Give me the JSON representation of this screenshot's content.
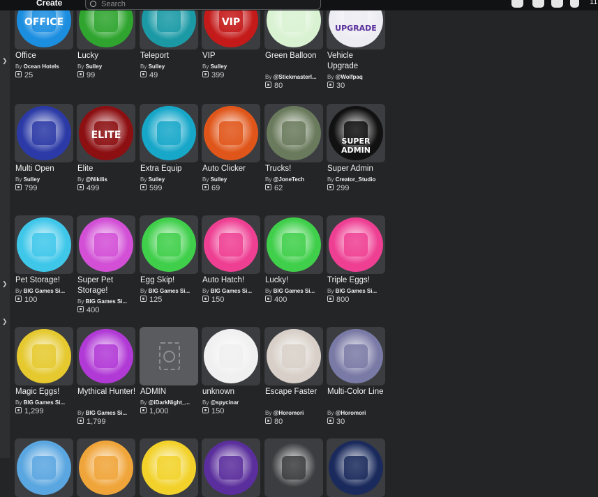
{
  "topbar": {
    "create_label": "Create",
    "search_placeholder": "Search",
    "right_icons": [
      "robux-icon",
      "chat-icon",
      "friends-icon",
      "shield-icon"
    ],
    "menu_tail": "11"
  },
  "rows": [
    [
      {
        "name": "Office",
        "creator": "Ocean Hotels",
        "price": "25",
        "icon": "office-icon",
        "bg": "#1c8ee0",
        "label": "OFFICE",
        "labelColor": "#ffffff"
      },
      {
        "name": "Lucky",
        "creator": "Sulley",
        "price": "99",
        "icon": "clover-icon",
        "bg": "#2fa52f",
        "label": "",
        "labelColor": ""
      },
      {
        "name": "Teleport",
        "creator": "Sulley",
        "price": "49",
        "icon": "teleport-icon",
        "bg": "#1b9aa6",
        "label": "",
        "labelColor": ""
      },
      {
        "name": "VIP",
        "creator": "Sulley",
        "price": "399",
        "icon": "vip-icon",
        "bg": "#c41a1a",
        "label": "VIP",
        "labelColor": "#ffffff"
      },
      {
        "name": "Green Balloon",
        "creator": "@StickmasterI...",
        "price": "80",
        "icon": "balloon-icon",
        "bg": "#d9f2d2",
        "label": "",
        "labelColor": ""
      },
      {
        "name": "Vehicle Upgrade",
        "creator": "@Wolfpaq",
        "price": "30",
        "icon": "car-upgrade-icon",
        "bg": "#ececf2",
        "label": "UPGRADE",
        "labelColor": "#5a2e9c"
      }
    ],
    [
      {
        "name": "Multi Open",
        "creator": "Sulley",
        "price": "799",
        "icon": "stars-icon",
        "bg": "#2b3aa6",
        "label": "",
        "labelColor": ""
      },
      {
        "name": "Elite",
        "creator": "@Nikilis",
        "price": "499",
        "icon": "skull-icon",
        "bg": "#8c0f12",
        "label": "ELITE",
        "labelColor": "#ffffff"
      },
      {
        "name": "Extra Equip",
        "creator": "Sulley",
        "price": "599",
        "icon": "plus-smile-icon",
        "bg": "#17a7c9",
        "label": "",
        "labelColor": ""
      },
      {
        "name": "Auto Clicker",
        "creator": "Sulley",
        "price": "69",
        "icon": "hand-click-icon",
        "bg": "#e0561a",
        "label": "",
        "labelColor": ""
      },
      {
        "name": "Trucks!",
        "creator": "@JoneTech",
        "price": "62",
        "icon": "truck-icon",
        "bg": "#6a7a5c",
        "label": "",
        "labelColor": ""
      },
      {
        "name": "Super Admin",
        "creator": "Creator_Studio",
        "price": "299",
        "icon": "super-admin-icon",
        "bg": "#111111",
        "label": "SUPER ADMIN",
        "labelColor": "#ffffff"
      }
    ],
    [
      {
        "name": "Pet Storage!",
        "creator": "BIG Games Si...",
        "price": "100",
        "icon": "backpack-icon",
        "bg": "#3fc7ea",
        "label": "",
        "labelColor": ""
      },
      {
        "name": "Super Pet Storage!",
        "creator": "BIG Games Si...",
        "price": "400",
        "icon": "super-backpack-icon",
        "bg": "#d24fd6",
        "label": "",
        "labelColor": ""
      },
      {
        "name": "Egg Skip!",
        "creator": "BIG Games Si...",
        "price": "125",
        "icon": "skip-icon",
        "bg": "#3fcf4a",
        "label": "",
        "labelColor": ""
      },
      {
        "name": "Auto Hatch!",
        "creator": "BIG Games Si...",
        "price": "150",
        "icon": "egg-hatch-icon",
        "bg": "#ee3f93",
        "label": "",
        "labelColor": ""
      },
      {
        "name": "Lucky!",
        "creator": "BIG Games Si...",
        "price": "400",
        "icon": "clover-icon",
        "bg": "#3fcf4a",
        "label": "",
        "labelColor": ""
      },
      {
        "name": "Triple Eggs!",
        "creator": "BIG Games Si...",
        "price": "800",
        "icon": "triple-eggs-icon",
        "bg": "#ee3f93",
        "label": "",
        "labelColor": ""
      }
    ],
    [
      {
        "name": "Magic Eggs!",
        "creator": "BIG Games Si...",
        "price": "1,299",
        "icon": "rainbow-egg-icon",
        "bg": "#e5c92f",
        "label": "",
        "labelColor": ""
      },
      {
        "name": "Mythical Hunter!",
        "creator": "BIG Games Si...",
        "price": "1,799",
        "icon": "mythical-clover-icon",
        "bg": "#b13ad6",
        "label": "",
        "labelColor": ""
      },
      {
        "name": "ADMIN",
        "creator": "@iDarkNight_...",
        "price": "1,000",
        "icon": "no-image-icon",
        "bg": "",
        "label": "",
        "labelColor": ""
      },
      {
        "name": "unknown",
        "creator": "@spycinar",
        "price": "150",
        "icon": "character-icon",
        "bg": "#f0f0f0",
        "label": "",
        "labelColor": ""
      },
      {
        "name": "Escape Faster",
        "creator": "@Horomori",
        "price": "80",
        "icon": "clock-icon",
        "bg": "#d8d0c8",
        "label": "",
        "labelColor": ""
      },
      {
        "name": "Multi-Color Line",
        "creator": "@Horomori",
        "price": "30",
        "icon": "color-lines-icon",
        "bg": "#7a7aa6",
        "label": "",
        "labelColor": ""
      }
    ],
    [
      {
        "name": "",
        "creator": "",
        "price": "",
        "icon": "partial-icon",
        "bg": "#5aa6e0",
        "label": "",
        "labelColor": ""
      },
      {
        "name": "",
        "creator": "",
        "price": "",
        "icon": "partial-icon",
        "bg": "#f0a53a",
        "label": "",
        "labelColor": ""
      },
      {
        "name": "",
        "creator": "",
        "price": "",
        "icon": "partial-icon",
        "bg": "#f2d22a",
        "label": "",
        "labelColor": ""
      },
      {
        "name": "",
        "creator": "",
        "price": "",
        "icon": "partial-icon",
        "bg": "#5a2e9c",
        "label": "",
        "labelColor": ""
      },
      {
        "name": "",
        "creator": "",
        "price": "",
        "icon": "partial-icon",
        "bg": "#3b3d40",
        "label": "",
        "labelColor": ""
      },
      {
        "name": "",
        "creator": "",
        "price": "",
        "icon": "partial-icon",
        "bg": "#1a2a5c",
        "label": "",
        "labelColor": ""
      }
    ]
  ],
  "by_prefix": "By"
}
